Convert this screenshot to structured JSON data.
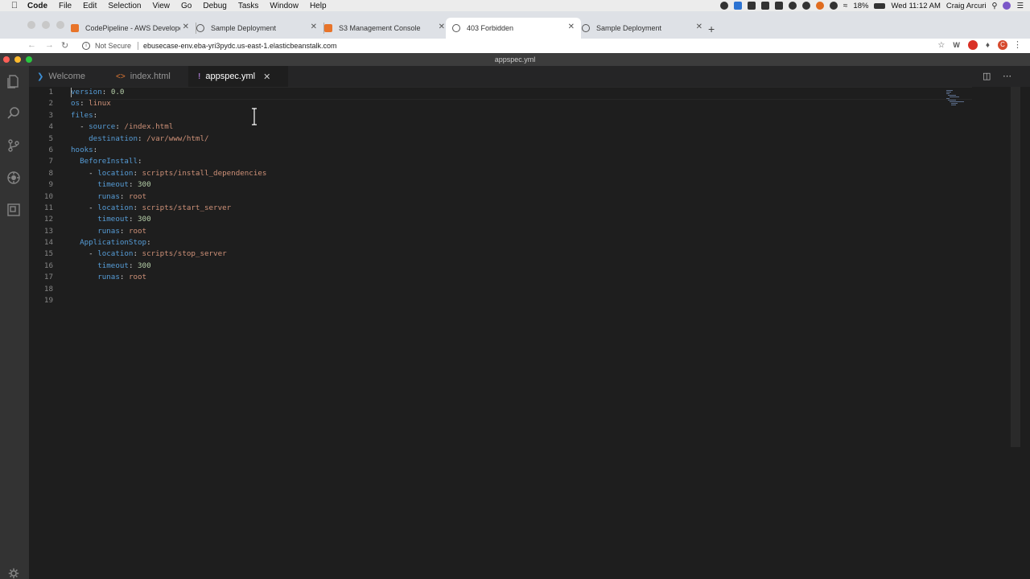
{
  "menubar": {
    "app": "Code",
    "items": [
      "File",
      "Edit",
      "Selection",
      "View",
      "Go",
      "Debug",
      "Tasks",
      "Window",
      "Help"
    ],
    "battery": "18%",
    "clock": "Wed 11:12 AM",
    "user": "Craig Arcuri"
  },
  "browser": {
    "tabs": [
      {
        "label": "CodePipeline - AWS Develope"
      },
      {
        "label": "Sample Deployment"
      },
      {
        "label": "S3 Management Console"
      },
      {
        "label": "403 Forbidden"
      },
      {
        "label": "Sample Deployment"
      }
    ],
    "not_secure": "Not Secure",
    "url": "ebusecase-env.eba-yri3pydc.us-east-1.elasticbeanstalk.com",
    "avatar_letter": "C"
  },
  "vscode": {
    "window_title": "appspec.yml",
    "tabs": [
      {
        "label": "Welcome"
      },
      {
        "label": "index.html"
      },
      {
        "label": "appspec.yml"
      }
    ],
    "lines": [
      {
        "n": "1",
        "indent": "",
        "key": "version",
        "sep": ": ",
        "val": "0.0",
        "vt": "n"
      },
      {
        "n": "2",
        "indent": "",
        "key": "os",
        "sep": ": ",
        "val": "linux",
        "vt": "v"
      },
      {
        "n": "3",
        "indent": "",
        "key": "files",
        "sep": ":",
        "val": "",
        "vt": "v"
      },
      {
        "n": "4",
        "indent": "  - ",
        "key": "source",
        "sep": ": ",
        "val": "/index.html",
        "vt": "v"
      },
      {
        "n": "5",
        "indent": "    ",
        "key": "destination",
        "sep": ": ",
        "val": "/var/www/html/",
        "vt": "v"
      },
      {
        "n": "6",
        "indent": "",
        "key": "hooks",
        "sep": ":",
        "val": "",
        "vt": "v"
      },
      {
        "n": "7",
        "indent": "  ",
        "key": "BeforeInstall",
        "sep": ":",
        "val": "",
        "vt": "v"
      },
      {
        "n": "8",
        "indent": "    - ",
        "key": "location",
        "sep": ": ",
        "val": "scripts/install_dependencies",
        "vt": "v"
      },
      {
        "n": "9",
        "indent": "      ",
        "key": "timeout",
        "sep": ": ",
        "val": "300",
        "vt": "n"
      },
      {
        "n": "10",
        "indent": "      ",
        "key": "runas",
        "sep": ": ",
        "val": "root",
        "vt": "v"
      },
      {
        "n": "11",
        "indent": "    - ",
        "key": "location",
        "sep": ": ",
        "val": "scripts/start_server",
        "vt": "v"
      },
      {
        "n": "12",
        "indent": "      ",
        "key": "timeout",
        "sep": ": ",
        "val": "300",
        "vt": "n"
      },
      {
        "n": "13",
        "indent": "      ",
        "key": "runas",
        "sep": ": ",
        "val": "root",
        "vt": "v"
      },
      {
        "n": "14",
        "indent": "  ",
        "key": "ApplicationStop",
        "sep": ":",
        "val": "",
        "vt": "v"
      },
      {
        "n": "15",
        "indent": "    - ",
        "key": "location",
        "sep": ": ",
        "val": "scripts/stop_server",
        "vt": "v"
      },
      {
        "n": "16",
        "indent": "      ",
        "key": "timeout",
        "sep": ": ",
        "val": "300",
        "vt": "n"
      },
      {
        "n": "17",
        "indent": "      ",
        "key": "runas",
        "sep": ": ",
        "val": "root",
        "vt": "v"
      },
      {
        "n": "18",
        "indent": "",
        "key": "",
        "sep": "",
        "val": "",
        "vt": "v"
      },
      {
        "n": "19",
        "indent": "",
        "key": "",
        "sep": "",
        "val": "",
        "vt": "v"
      }
    ]
  }
}
